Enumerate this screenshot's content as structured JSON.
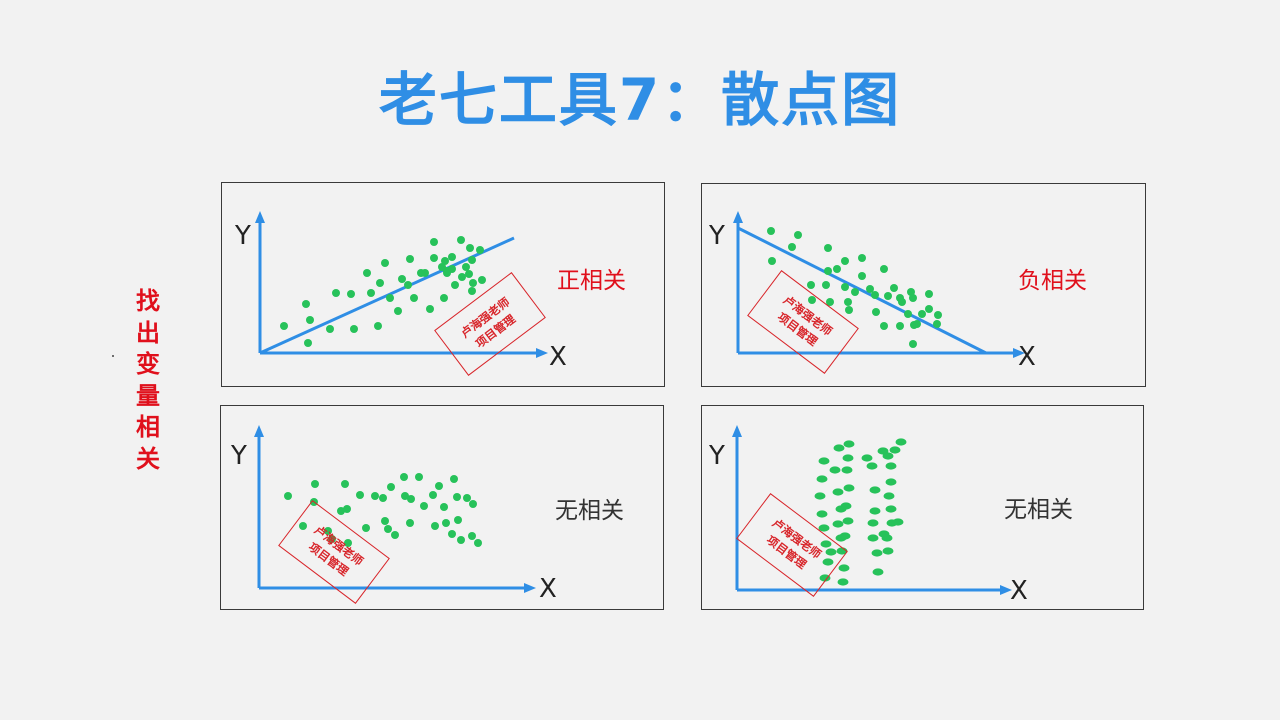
{
  "title": "老七工具7：散点图",
  "side_label": [
    "找",
    "出",
    "变",
    "量",
    "相",
    "关"
  ],
  "colors": {
    "title": "#2f8ee5",
    "axis": "#2f8ee5",
    "dots": "#27c25a",
    "red_label": "#e0101c",
    "stamp": "#d8252a"
  },
  "watermark": [
    "卢海强老师",
    "项目管理"
  ],
  "panels": [
    {
      "id": "positive",
      "axis_y": "Y",
      "axis_x": "X",
      "relation": "正相关",
      "relation_color": "red"
    },
    {
      "id": "negative",
      "axis_y": "Y",
      "axis_x": "X",
      "relation": "负相关",
      "relation_color": "red"
    },
    {
      "id": "none-cloud",
      "axis_y": "Y",
      "axis_x": "X",
      "relation": "无相关",
      "relation_color": "dark"
    },
    {
      "id": "none-vertical",
      "axis_y": "Y",
      "axis_x": "X",
      "relation": "无相关",
      "relation_color": "dark"
    }
  ]
}
